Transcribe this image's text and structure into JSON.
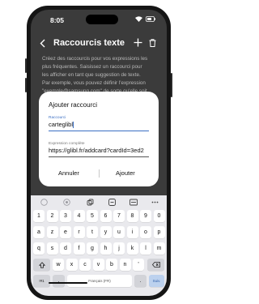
{
  "status_bar": {
    "time": "8:05"
  },
  "app_bar": {
    "title": "Raccourcis texte"
  },
  "description": [
    "Créez des raccourcis pour vos expressions les",
    "plus fréquentes. Saisissez un raccourci pour",
    "les afficher en tant que suggestion de texte.",
    "Par exemple, vous pouvez définir l'expression",
    "\"exemple@samsung.com\" de sorte qu'elle soit"
  ],
  "dialog": {
    "title": "Ajouter raccourci",
    "shortcut": {
      "label": "Raccourci",
      "value": "carteglibl"
    },
    "expression": {
      "label": "Expression complète",
      "value": "https://glibl.fr/addcard?cardId=3ed2"
    },
    "cancel_label": "Annuler",
    "add_label": "Ajouter"
  },
  "keyboard": {
    "number_row": [
      "1",
      "2",
      "3",
      "4",
      "5",
      "6",
      "7",
      "8",
      "9",
      "0"
    ],
    "row1": [
      "a",
      "z",
      "e",
      "r",
      "t",
      "y",
      "u",
      "i",
      "o",
      "p"
    ],
    "row2": [
      "q",
      "s",
      "d",
      "f",
      "g",
      "h",
      "j",
      "k",
      "l",
      "m"
    ],
    "row3": [
      "w",
      "x",
      "c",
      "v",
      "b",
      "n"
    ],
    "row3_extra": "'",
    "symbols_key": "!#1",
    "comma_key": ",",
    "space_label": "Français (FR)",
    "period_key": ".",
    "enter_label": "Suiv."
  },
  "colors": {
    "accent": "#3b6fc4",
    "screen_bg": "#3b3b3b",
    "keyboard_bg": "#e9e9ed"
  }
}
